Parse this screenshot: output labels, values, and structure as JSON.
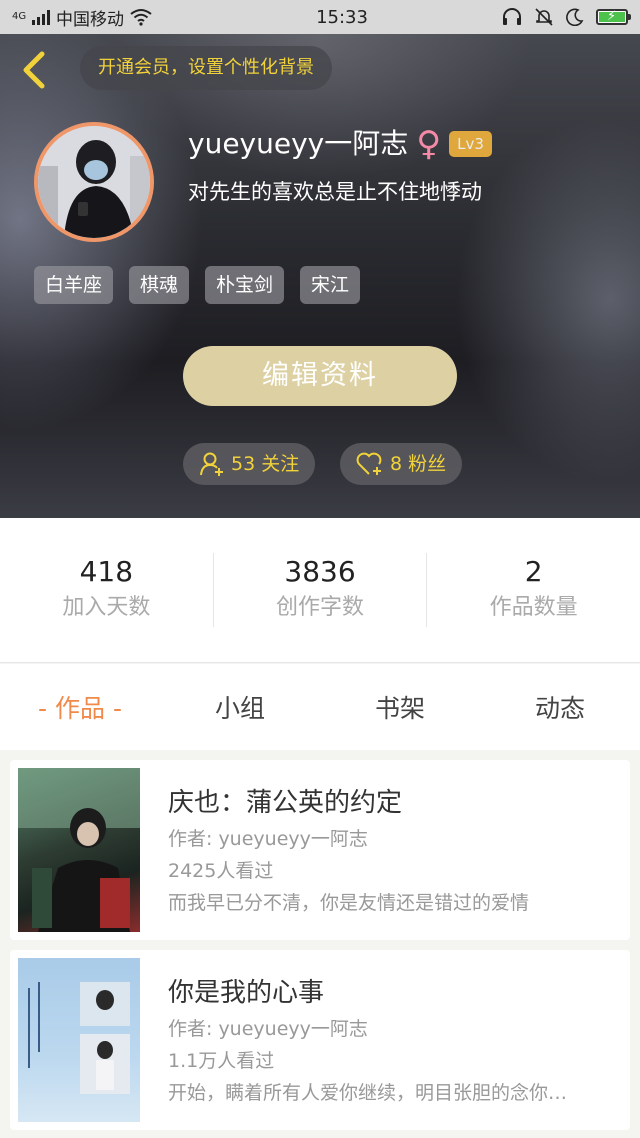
{
  "status_bar": {
    "network": "4G",
    "carrier": "中国移动",
    "time": "15:33"
  },
  "header": {
    "back_icon": "chevron-left-icon",
    "vip_promo": "开通会员，设置个性化背景",
    "username": "yueyueyy一阿志",
    "gender_symbol": "♀",
    "level": "Lv3",
    "bio": "对先生的喜欢总是止不住地悸动",
    "tags": [
      "白羊座",
      "棋魂",
      "朴宝剑",
      "宋江"
    ],
    "edit_button": "编辑资料",
    "following_label": "53 关注",
    "fans_label": "8 粉丝",
    "colors": {
      "accent_yellow": "#f2d23a",
      "avatar_border": "#f08a4b",
      "edit_button_bg": "#ddd1a4"
    }
  },
  "stats": [
    {
      "value": "418",
      "label": "加入天数"
    },
    {
      "value": "3836",
      "label": "创作字数"
    },
    {
      "value": "2",
      "label": "作品数量"
    }
  ],
  "tabs": [
    {
      "label": "- 作品 -",
      "active": true
    },
    {
      "label": "小组",
      "active": false
    },
    {
      "label": "书架",
      "active": false
    },
    {
      "label": "动态",
      "active": false
    }
  ],
  "works": [
    {
      "title": "庆也：蒲公英的约定",
      "author": "作者: yueyueyy一阿志",
      "views": "2425人看过",
      "desc": "而我早已分不清，你是友情还是错过的爱情"
    },
    {
      "title": "你是我的心事",
      "author": "作者: yueyueyy一阿志",
      "views": "1.1万人看过",
      "desc": "开始，瞒着所有人爱你继续，明目张胆的念你…"
    }
  ]
}
